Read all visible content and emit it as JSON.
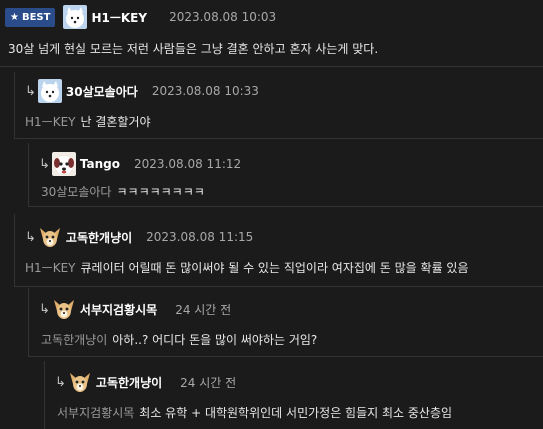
{
  "badge": {
    "star": "★",
    "label": "BEST"
  },
  "comments": [
    {
      "name": "H1ㅡKEY",
      "date": "2023.08.08 10:03",
      "mention": "",
      "text": "30살 넘게 현실 모르는 저런 사람들은 그냥 결혼 안하고 혼자 사는게 맞다.",
      "avatar": "samoyed-avatar"
    },
    {
      "name": "30살모솔아다",
      "date": "2023.08.08 10:33",
      "mention": "H1ㅡKEY",
      "text": "난 결혼할거야",
      "avatar": "samoyed-avatar"
    },
    {
      "name": "Tango",
      "date": "2023.08.08 11:12",
      "mention": "30살모솔아다",
      "text": "ㅋㅋㅋㅋㅋㅋㅋㅋ",
      "avatar": "dog-avatar"
    },
    {
      "name": "고독한개냥이",
      "date": "2023.08.08 11:15",
      "mention": "H1ㅡKEY",
      "text": "큐레이터 어릴때 돈 많이써야 될 수 있는 직업이라 여자집에 돈 많을 확률 있음",
      "avatar": "chihuahua-avatar"
    },
    {
      "name": "서부지검황시목",
      "date": "24 시간 전",
      "mention": "고독한개냥이",
      "text": "아하..? 어디다 돈을 많이 써야하는 거임?",
      "avatar": "chihuahua-avatar"
    },
    {
      "name": "고독한개냥이",
      "date": "24 시간 전",
      "mention": "서부지검황시목",
      "text": "최소 유학 + 대학원학위인데 서민가정은 힘들지 최소 중산층임",
      "avatar": "chihuahua-avatar"
    }
  ],
  "reply_arrow": "↳"
}
